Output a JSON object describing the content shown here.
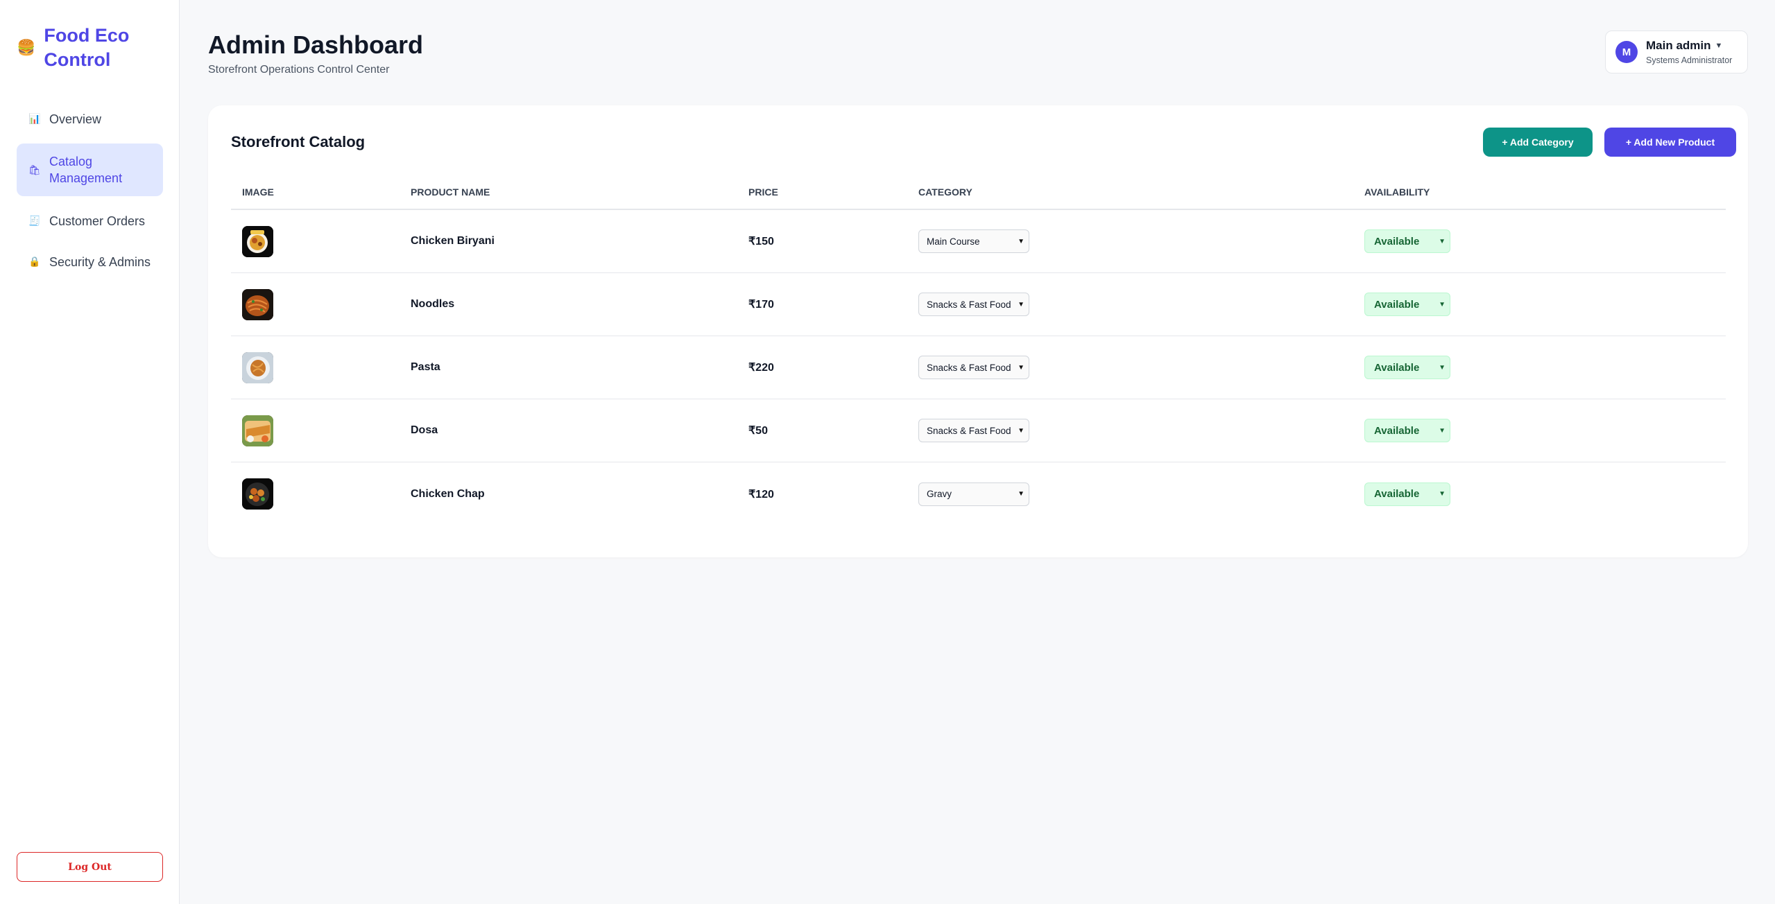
{
  "brand": {
    "icon": "burger-icon",
    "title": "Food Eco Control"
  },
  "sidebar": {
    "items": [
      {
        "label": "Overview",
        "icon": "bar-chart-icon",
        "active": false
      },
      {
        "label": "Catalog Management",
        "icon": "shopping-bags-icon",
        "active": true
      },
      {
        "label": "Customer Orders",
        "icon": "receipt-icon",
        "active": false
      },
      {
        "label": "Security & Admins",
        "icon": "lock-icon",
        "active": false
      }
    ],
    "logout_label": "Log Out"
  },
  "header": {
    "title": "Admin Dashboard",
    "subtitle": "Storefront Operations Control Center"
  },
  "user": {
    "avatar_letter": "M",
    "name": "Main admin",
    "role": "Systems Administrator"
  },
  "catalog": {
    "title": "Storefront Catalog",
    "add_category_label": "+ Add Category",
    "add_product_label": "+ Add New Product",
    "columns": [
      "IMAGE",
      "PRODUCT NAME",
      "PRICE",
      "CATEGORY",
      "AVAILABILITY"
    ],
    "rows": [
      {
        "name": "Chicken Biryani",
        "price": "₹150",
        "category": "Main Course",
        "availability": "Available"
      },
      {
        "name": "Noodles",
        "price": "₹170",
        "category": "Snacks & Fast Food",
        "availability": "Available"
      },
      {
        "name": "Pasta",
        "price": "₹220",
        "category": "Snacks & Fast Food",
        "availability": "Available"
      },
      {
        "name": "Dosa",
        "price": "₹50",
        "category": "Snacks & Fast Food",
        "availability": "Available"
      },
      {
        "name": "Chicken Chap",
        "price": "₹120",
        "category": "Gravy",
        "availability": "Available"
      }
    ]
  },
  "colors": {
    "accent": "#4f46e5",
    "teal": "#0d9488",
    "available_bg": "#dcfce7",
    "available_text": "#166534",
    "danger": "#dc2626"
  }
}
